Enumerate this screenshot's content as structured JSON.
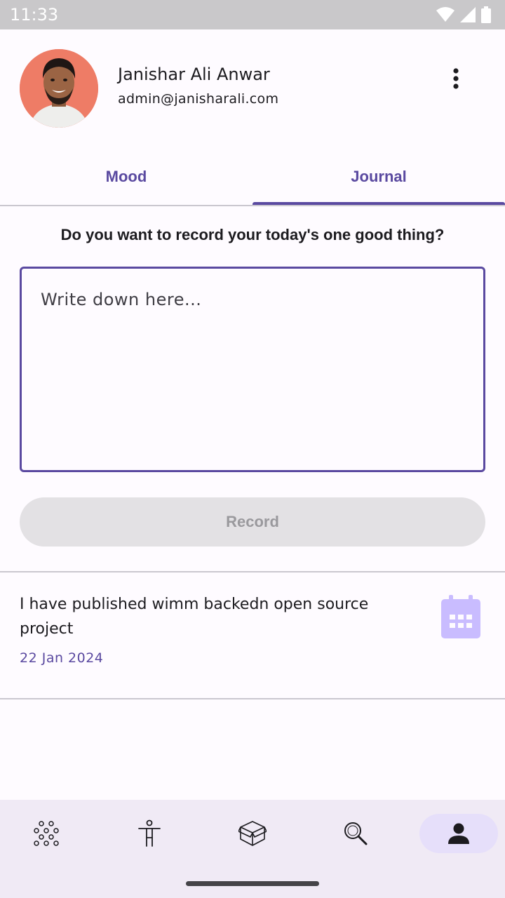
{
  "status_bar": {
    "time": "11:33"
  },
  "profile": {
    "name": "Janishar Ali Anwar",
    "email": "admin@janisharali.com"
  },
  "tabs": [
    {
      "label": "Mood",
      "active": false
    },
    {
      "label": "Journal",
      "active": true
    }
  ],
  "journal": {
    "prompt": "Do you want to record your today's one good thing?",
    "placeholder": "Write down here...",
    "value": "",
    "record_label": "Record"
  },
  "entries": [
    {
      "text": "I have published wimm backedn open source project",
      "date": "22 Jan 2024",
      "icon": "calendar-icon"
    }
  ],
  "bottom_nav": [
    {
      "icon": "dots-cluster-icon",
      "active": false
    },
    {
      "icon": "person-standing-icon",
      "active": false
    },
    {
      "icon": "box-icon",
      "active": false
    },
    {
      "icon": "search-icon",
      "active": false
    },
    {
      "icon": "profile-icon",
      "active": true
    }
  ],
  "colors": {
    "primary": "#5a49a0",
    "background": "#fefbff",
    "nav_background": "#f0eaf5",
    "active_pill": "#e6dffa",
    "calendar": "#c9bcff"
  }
}
